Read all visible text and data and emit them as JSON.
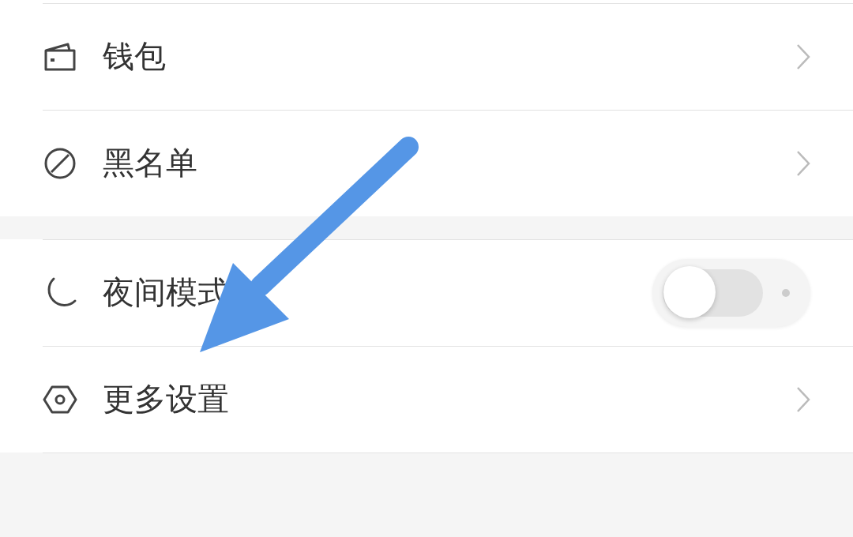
{
  "sections": [
    {
      "items": [
        {
          "kind": "link",
          "label": "钱包"
        },
        {
          "kind": "link",
          "label": "黑名单"
        }
      ]
    },
    {
      "items": [
        {
          "kind": "toggle",
          "label": "夜间模式",
          "on": false
        },
        {
          "kind": "link",
          "label": "更多设置"
        }
      ]
    }
  ]
}
